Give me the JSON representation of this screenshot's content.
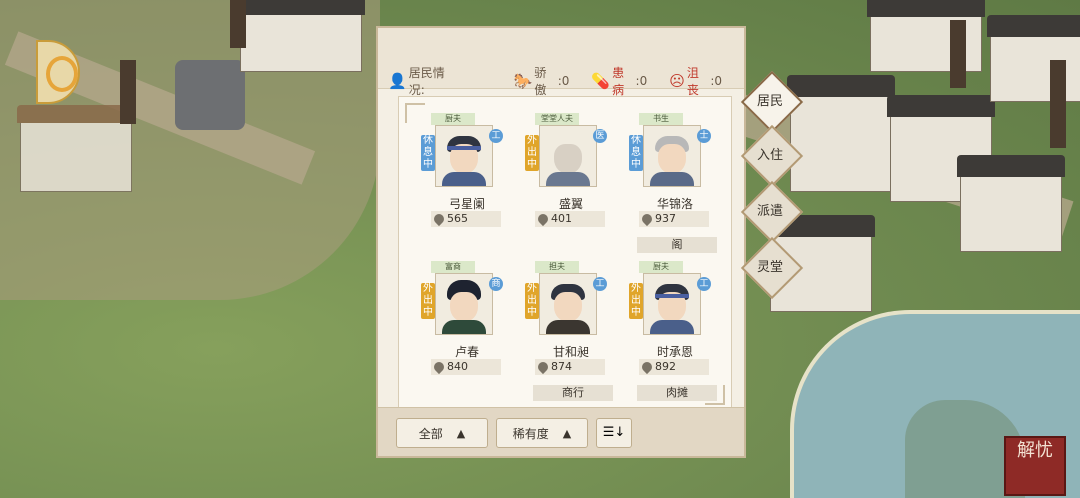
{
  "panel": {
    "status_label": "居民情况:",
    "stats": [
      {
        "icon": "horse-icon",
        "label": "骄傲",
        "value": "0"
      },
      {
        "icon": "pill-icon",
        "label": "患病",
        "value": "0"
      },
      {
        "icon": "sad-face-icon",
        "label": "沮丧",
        "value": "0"
      }
    ]
  },
  "residents": [
    {
      "role": "厨夫",
      "state": "休息中",
      "job": "工",
      "name": "弓星阑",
      "score": "565",
      "place": ""
    },
    {
      "role": "堂堂人夫",
      "state": "外出中",
      "job": "医",
      "name": "盛翼",
      "score": "401",
      "place": ""
    },
    {
      "role": "书生",
      "state": "休息中",
      "job": "士",
      "name": "华锦洛",
      "score": "937",
      "place": "阁"
    },
    {
      "role": "富商",
      "state": "外出中",
      "job": "商",
      "name": "卢春",
      "score": "840",
      "place": ""
    },
    {
      "role": "担夫",
      "state": "外出中",
      "job": "工",
      "name": "甘和昶",
      "score": "874",
      "place": "商行"
    },
    {
      "role": "厨夫",
      "state": "外出中",
      "job": "工",
      "name": "时承恩",
      "score": "892",
      "place": "肉摊"
    }
  ],
  "footer": {
    "sort_all": "全部",
    "sort_rarity": "稀有度",
    "order_icon": "sort-order-icon"
  },
  "tabs": [
    "居民",
    "入住",
    "派遣",
    "灵堂"
  ],
  "seal_text": "解忧",
  "colors": {
    "rest": "#5b9cd6",
    "out": "#e0a52a",
    "seal": "#8e2a26"
  }
}
